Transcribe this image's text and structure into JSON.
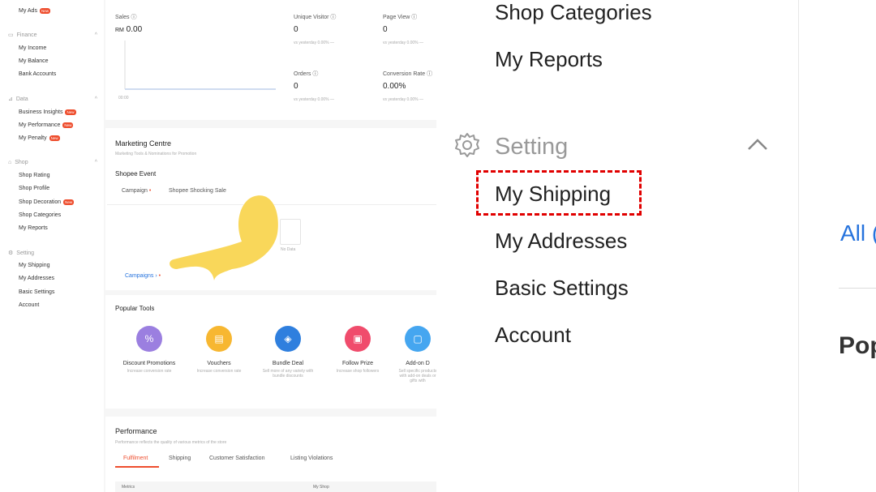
{
  "sidebar": {
    "top_item": {
      "label": "My Ads",
      "badge": "New"
    },
    "groups": [
      {
        "title": "Finance",
        "items": [
          {
            "label": "My Income"
          },
          {
            "label": "My Balance"
          },
          {
            "label": "Bank Accounts"
          }
        ]
      },
      {
        "title": "Data",
        "items": [
          {
            "label": "Business Insights",
            "badge": "New"
          },
          {
            "label": "My Performance",
            "badge": "New"
          },
          {
            "label": "My Penalty",
            "badge": "New"
          }
        ]
      },
      {
        "title": "Shop",
        "items": [
          {
            "label": "Shop Rating"
          },
          {
            "label": "Shop Profile"
          },
          {
            "label": "Shop Decoration",
            "badge": "New"
          },
          {
            "label": "Shop Categories"
          },
          {
            "label": "My Reports"
          }
        ]
      },
      {
        "title": "Setting",
        "items": [
          {
            "label": "My Shipping"
          },
          {
            "label": "My Addresses"
          },
          {
            "label": "Basic Settings"
          },
          {
            "label": "Account"
          }
        ]
      }
    ]
  },
  "stats": {
    "sales_label": "Sales",
    "sales_currency": "RM",
    "sales_value": "0.00",
    "time_label": "00:00",
    "unique_visitor_label": "Unique Visitor",
    "unique_visitor_value": "0",
    "page_view_label": "Page View",
    "page_view_value": "0",
    "orders_label": "Orders",
    "orders_value": "0",
    "conversion_label": "Conversion Rate",
    "conversion_value": "0.00%",
    "vs_text": "vs yesterday 0.00% —"
  },
  "marketing": {
    "title": "Marketing Centre",
    "subtitle": "Marketing Tools & Nominations for Promotion",
    "event_title": "Shopee Event",
    "tab1": "Campaign",
    "tab2": "Shopee Shocking Sale",
    "no_data": "No Data",
    "more_link": "Campaigns"
  },
  "tools": {
    "title": "Popular Tools",
    "items": [
      {
        "name": "Discount Promotions",
        "desc": "Increase conversion rate",
        "color": "#9b7fe0",
        "icon": "%"
      },
      {
        "name": "Vouchers",
        "desc": "Increase conversion rate",
        "color": "#f7b731",
        "icon": "▤"
      },
      {
        "name": "Bundle Deal",
        "desc": "Sell more of any variety with bundle discounts",
        "color": "#2f7fde",
        "icon": "◈"
      },
      {
        "name": "Follow Prize",
        "desc": "Increase shop followers",
        "color": "#f04c6c",
        "icon": "▣"
      },
      {
        "name": "Add-on D",
        "desc": "Sell specific products with add-on deals or gifts with",
        "color": "#45a6f0",
        "icon": "▢"
      }
    ]
  },
  "performance": {
    "title": "Performance",
    "subtitle": "Performance reflects the quality of various metrics of the store",
    "tabs": [
      "Fulfilment",
      "Shipping",
      "Customer Satisfaction",
      "Listing Violations"
    ],
    "col1": "Metrics",
    "col2": "My Shop"
  },
  "menu": {
    "shop_categories": "Shop Categories",
    "my_reports": "My Reports",
    "setting_title": "Setting",
    "my_shipping": "My Shipping",
    "my_addresses": "My Addresses",
    "basic_settings": "Basic Settings",
    "account": "Account"
  },
  "right_panel": {
    "all_text": "All (",
    "pop_text": "Pop"
  },
  "colors": {
    "accent": "#ee4d2d",
    "highlight": "#e10000",
    "link": "#2673dd",
    "hand": "#f9d75a"
  }
}
